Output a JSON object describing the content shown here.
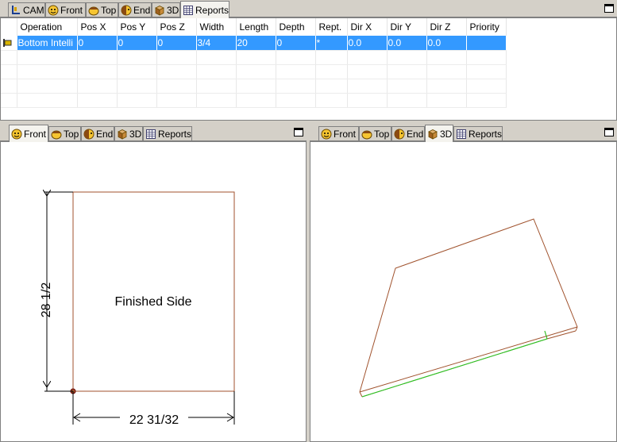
{
  "top_pane": {
    "tabs": [
      {
        "label": "CAM",
        "icon": "cam-icon",
        "active": false
      },
      {
        "label": "Front",
        "icon": "front-view-icon",
        "active": false
      },
      {
        "label": "Top",
        "icon": "top-view-icon",
        "active": false
      },
      {
        "label": "End",
        "icon": "end-view-icon",
        "active": false
      },
      {
        "label": "3D",
        "icon": "3d-view-icon",
        "active": false
      },
      {
        "label": "Reports",
        "icon": "reports-icon",
        "active": true
      }
    ],
    "grid": {
      "columns": [
        "Operation",
        "Pos X",
        "Pos Y",
        "Pos Z",
        "Width",
        "Length",
        "Depth",
        "Rept.",
        "Dir X",
        "Dir Y",
        "Dir Z",
        "Priority"
      ],
      "rows": [
        [
          "Bottom Intelli",
          "0",
          "0",
          "0",
          "3/4",
          "20",
          "0",
          "*",
          "0.0",
          "0.0",
          "0.0",
          ""
        ]
      ]
    }
  },
  "left_pane": {
    "tabs": [
      {
        "label": "Front",
        "icon": "front-view-icon",
        "active": true
      },
      {
        "label": "Top",
        "icon": "top-view-icon",
        "active": false
      },
      {
        "label": "End",
        "icon": "end-view-icon",
        "active": false
      },
      {
        "label": "3D",
        "icon": "3d-view-icon",
        "active": false
      },
      {
        "label": "Reports",
        "icon": "reports-icon",
        "active": false
      }
    ],
    "drawing": {
      "face_label": "Finished Side",
      "height_dim": "28 1/2",
      "width_dim": "22 31/32",
      "part_color": "#a0522d"
    }
  },
  "right_pane": {
    "tabs": [
      {
        "label": "Front",
        "icon": "front-view-icon",
        "active": false
      },
      {
        "label": "Top",
        "icon": "top-view-icon",
        "active": false
      },
      {
        "label": "End",
        "icon": "end-view-icon",
        "active": false
      },
      {
        "label": "3D",
        "icon": "3d-view-icon",
        "active": true
      },
      {
        "label": "Reports",
        "icon": "reports-icon",
        "active": false
      }
    ],
    "drawing": {
      "part_color": "#a0522d",
      "edge_color": "#22cc22"
    }
  }
}
